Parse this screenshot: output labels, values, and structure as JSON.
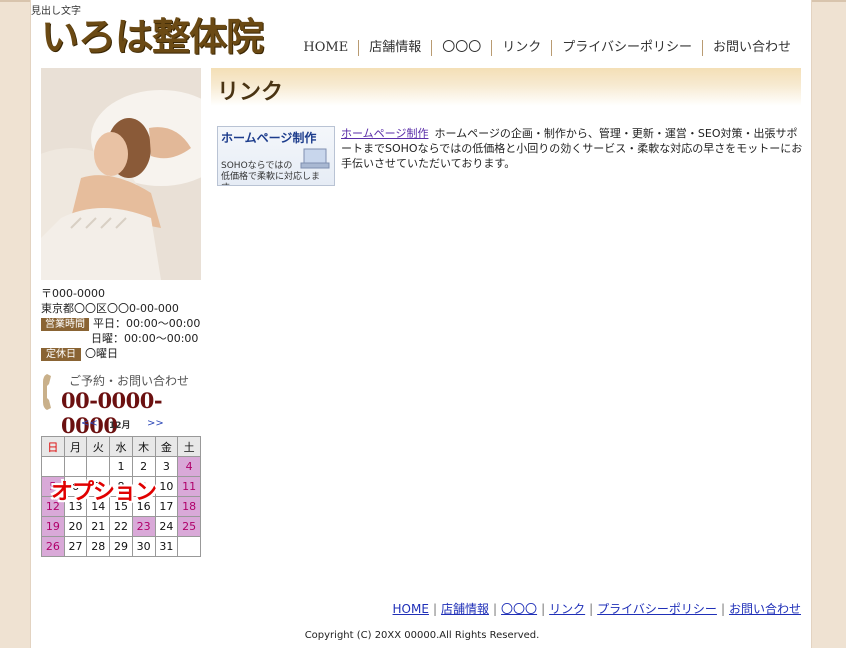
{
  "site": {
    "tagline": "見出し文字",
    "logo": "いろは整体院"
  },
  "nav": {
    "items": [
      "HOME",
      "店舗情報",
      "〇〇〇",
      "リンク",
      "プライバシーポリシー",
      "お問い合わせ"
    ]
  },
  "sidebar": {
    "postal": "〒000-0000",
    "address": "東京都〇〇区〇〇0-00-000",
    "hours_badge": "営業時間",
    "hours_weekday": "平日：00:00～00:00",
    "hours_sunday": "日曜：00:00～00:00",
    "closed_badge": "定休日",
    "closed_day": "〇曜日",
    "contact_label": "ご予約・お問い合わせ",
    "phone": "00-0000-0000"
  },
  "calendar": {
    "prev": "<<",
    "month": "12月",
    "next": ">>",
    "days": [
      "日",
      "月",
      "火",
      "水",
      "木",
      "金",
      "土"
    ],
    "weeks": [
      [
        "",
        "",
        "",
        "1",
        "2",
        "3",
        "4"
      ],
      [
        "5",
        "6",
        "7",
        "8",
        "9",
        "10",
        "11"
      ],
      [
        "12",
        "13",
        "14",
        "15",
        "16",
        "17",
        "18"
      ],
      [
        "19",
        "20",
        "21",
        "22",
        "23",
        "24",
        "25"
      ],
      [
        "26",
        "27",
        "28",
        "29",
        "30",
        "31",
        ""
      ]
    ],
    "overlay": "オプション"
  },
  "main": {
    "heading": "リンク",
    "banner_title": "ホームページ制作",
    "banner_sub1": "SOHOならではの",
    "banner_sub2": "低価格で柔軟に対応します。",
    "link_label": "ホームページ制作",
    "link_desc": "ホームページの企画・制作から、管理・更新・運営・SEO対策・出張サポートまでSOHOならではの低価格と小回りの効くサービス・柔軟な対応の早さをモットーにお手伝いさせていただいております。"
  },
  "footer": {
    "links": [
      "HOME",
      "店舗情報",
      "〇〇〇",
      "リンク",
      "プライバシーポリシー",
      "お問い合わせ"
    ],
    "copyright": "Copyright (C) 20XX 00000.All Rights Reserved."
  },
  "colors": {
    "brand_brown": "#6b4a14",
    "phone_red": "#6b1010",
    "holiday_pink": "#d9a9d8",
    "link_blue": "#2030b8"
  }
}
